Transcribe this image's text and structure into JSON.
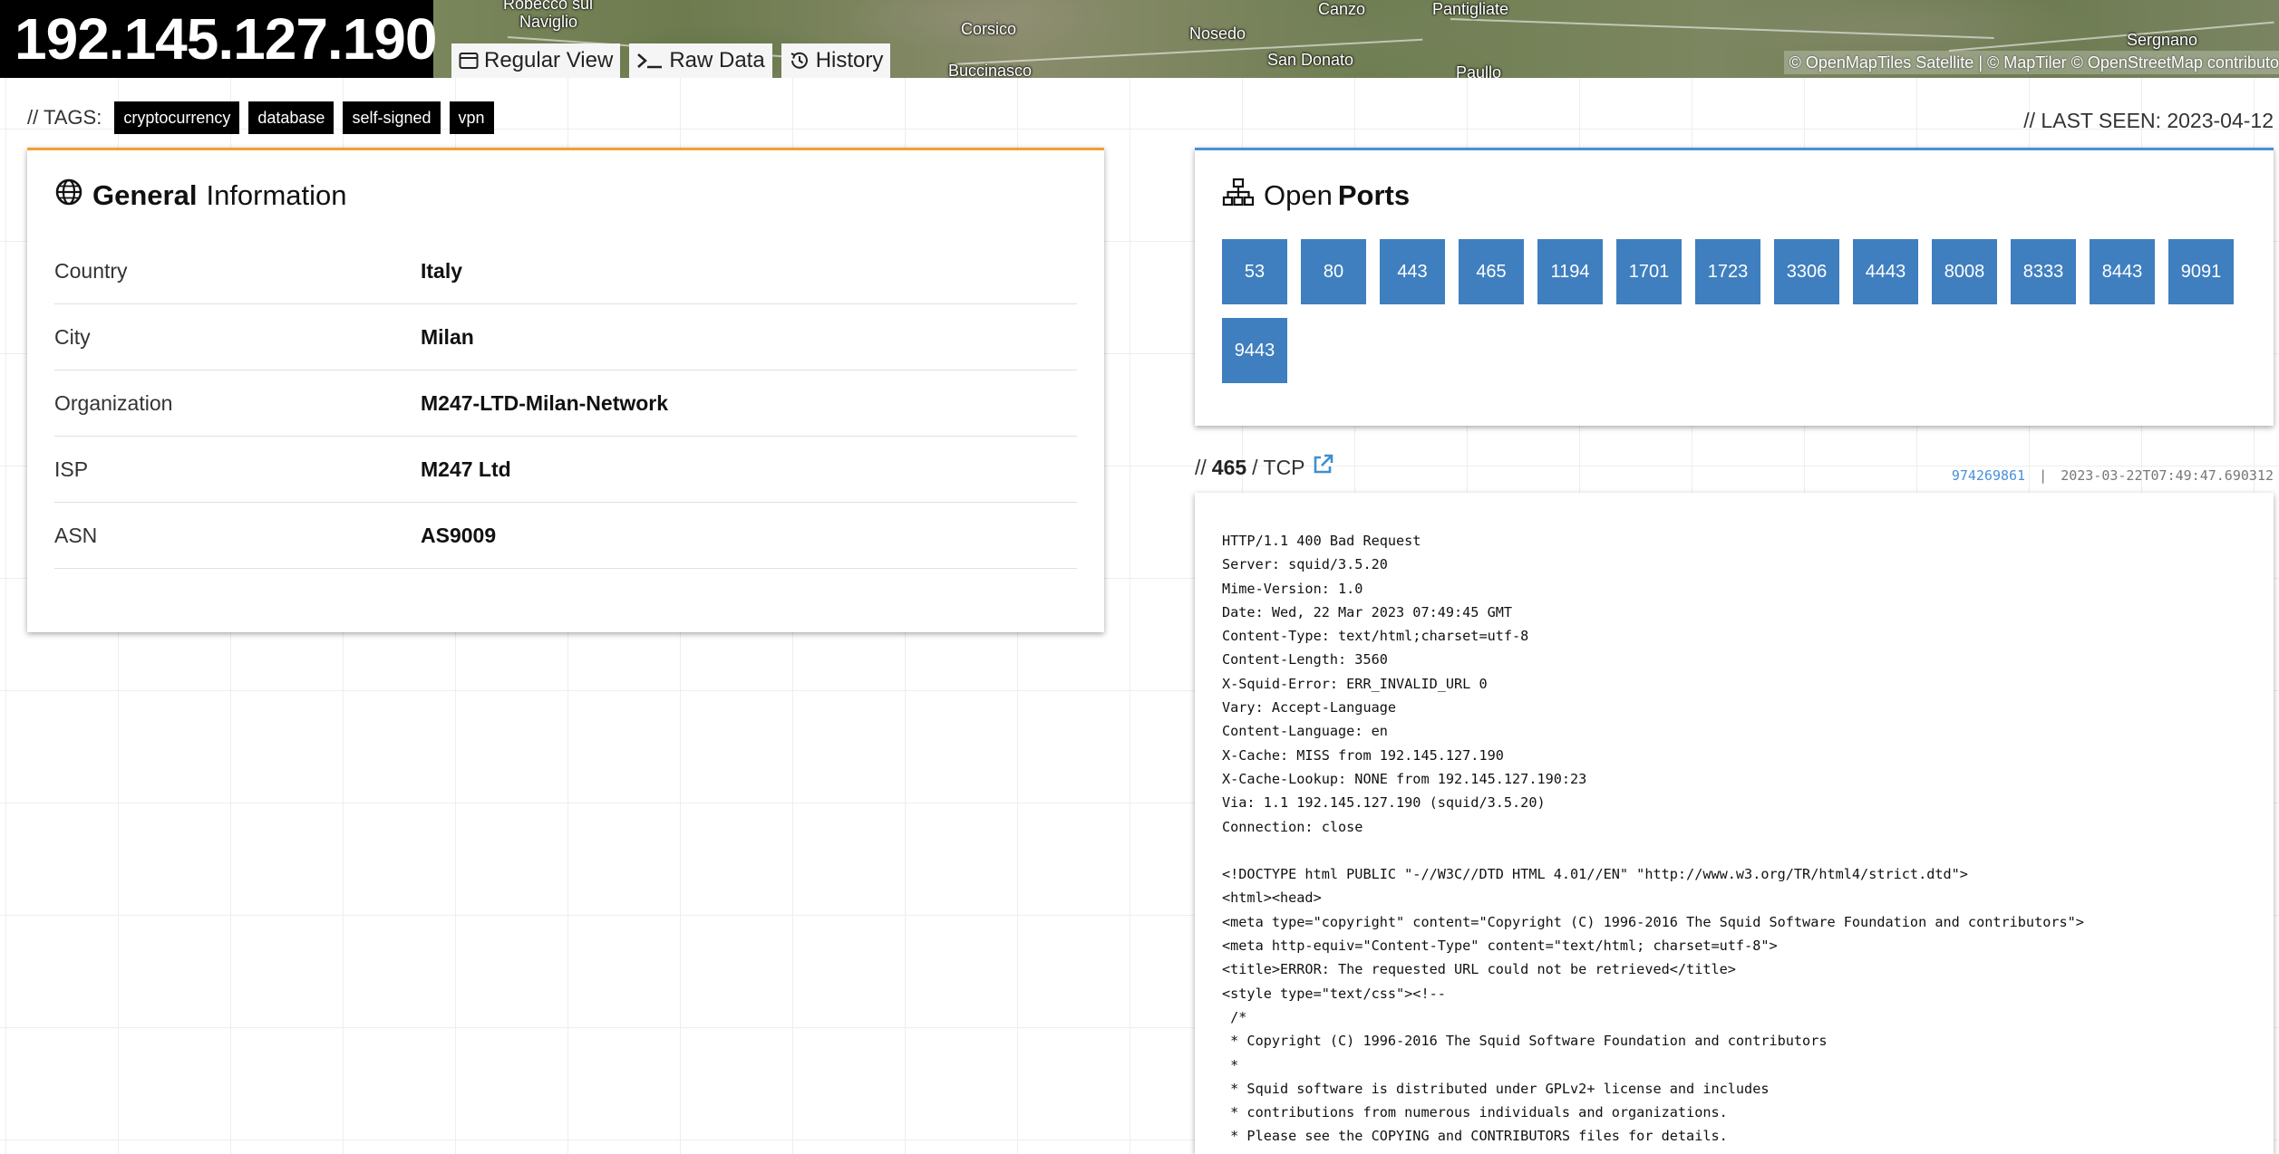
{
  "header": {
    "ip": "192.145.127.190",
    "tabs": [
      {
        "label": "Regular View",
        "icon": "window-icon"
      },
      {
        "label": "Raw Data",
        "icon": "terminal-icon"
      },
      {
        "label": "History",
        "icon": "history-icon"
      }
    ],
    "map_labels": [
      "Robecco sul",
      "Naviglio",
      "Corsico",
      "Buccinasco",
      "Nosedo",
      "San Donato",
      "Canzo",
      "Pantigliate",
      "Paullo",
      "Sergnano"
    ],
    "attribution": "© OpenMapTiles Satellite | © MapTiler © OpenStreetMap contributo"
  },
  "tags": {
    "label": "// TAGS:",
    "items": [
      "cryptocurrency",
      "database",
      "self-signed",
      "vpn"
    ]
  },
  "last_seen": "// LAST SEEN: 2023-04-12",
  "general": {
    "title_bold": "General",
    "title_rest": "Information",
    "accent": "#f0a030",
    "rows": [
      {
        "key": "Country",
        "value": "Italy"
      },
      {
        "key": "City",
        "value": "Milan"
      },
      {
        "key": "Organization",
        "value": "M247-LTD-Milan-Network"
      },
      {
        "key": "ISP",
        "value": "M247 Ltd"
      },
      {
        "key": "ASN",
        "value": "AS9009"
      }
    ]
  },
  "ports": {
    "title_rest": "Open",
    "title_bold": "Ports",
    "accent": "#4a90d9",
    "list": [
      "53",
      "80",
      "443",
      "465",
      "1194",
      "1701",
      "1723",
      "3306",
      "4443",
      "8008",
      "8333",
      "8443",
      "9091",
      "9443"
    ]
  },
  "port_detail": {
    "prefix": "//",
    "port": "465",
    "proto": "/ TCP",
    "hash": "974269861",
    "separator": "|",
    "timestamp": "2023-03-22T07:49:47.690312",
    "banner": "HTTP/1.1 400 Bad Request\nServer: squid/3.5.20\nMime-Version: 1.0\nDate: Wed, 22 Mar 2023 07:49:45 GMT\nContent-Type: text/html;charset=utf-8\nContent-Length: 3560\nX-Squid-Error: ERR_INVALID_URL 0\nVary: Accept-Language\nContent-Language: en\nX-Cache: MISS from 192.145.127.190\nX-Cache-Lookup: NONE from 192.145.127.190:23\nVia: 1.1 192.145.127.190 (squid/3.5.20)\nConnection: close\n\n<!DOCTYPE html PUBLIC \"-//W3C//DTD HTML 4.01//EN\" \"http://www.w3.org/TR/html4/strict.dtd\">\n<html><head>\n<meta type=\"copyright\" content=\"Copyright (C) 1996-2016 The Squid Software Foundation and contributors\">\n<meta http-equiv=\"Content-Type\" content=\"text/html; charset=utf-8\">\n<title>ERROR: The requested URL could not be retrieved</title>\n<style type=\"text/css\"><!--\n /*\n * Copyright (C) 1996-2016 The Squid Software Foundation and contributors\n *\n * Squid software is distributed under GPLv2+ license and includes\n * contributions from numerous individuals and organizations.\n * Please see the COPYING and CONTRIBUTORS files for details."
  }
}
